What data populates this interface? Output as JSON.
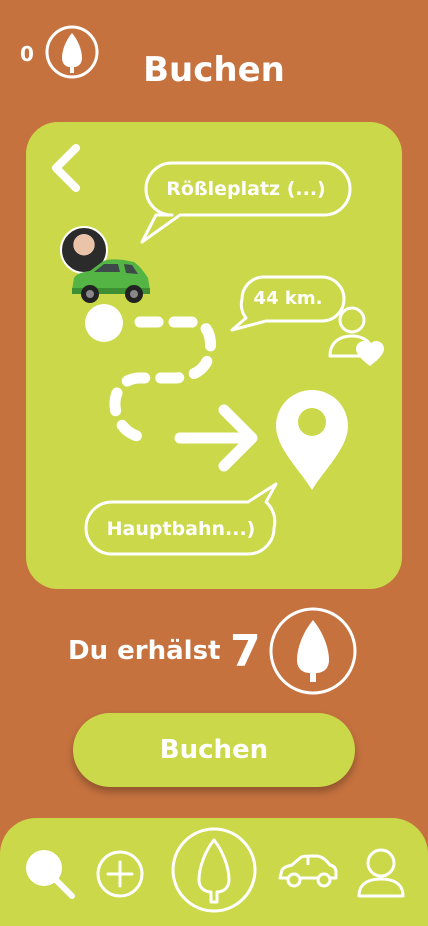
{
  "header": {
    "points": "0",
    "title": "Buchen"
  },
  "route": {
    "origin": "Rößleplatz (...)",
    "distance": "44 km.",
    "destination": "Hauptbahn...)"
  },
  "reward": {
    "label": "Du erhälst",
    "amount": "7"
  },
  "actions": {
    "book_label": "Buchen"
  },
  "colors": {
    "background": "#c6723f",
    "accent": "#cbd84a",
    "foreground": "#ffffff"
  },
  "nav": {
    "items": [
      "search-icon",
      "add-icon",
      "tree-icon",
      "car-icon",
      "profile-icon"
    ]
  }
}
